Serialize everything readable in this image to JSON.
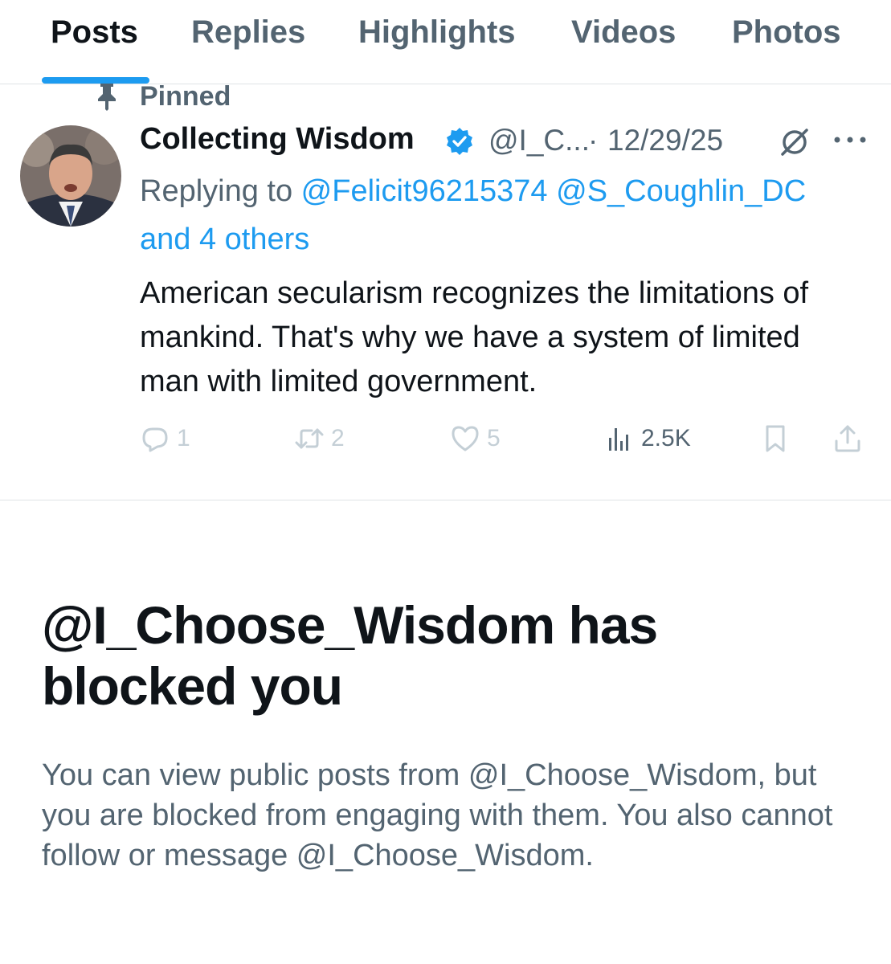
{
  "tabs": [
    {
      "label": "Posts",
      "active": true
    },
    {
      "label": "Replies",
      "active": false
    },
    {
      "label": "Highlights",
      "active": false
    },
    {
      "label": "Videos",
      "active": false
    },
    {
      "label": "Photos",
      "active": false
    }
  ],
  "pinned": {
    "label": "Pinned",
    "icon": "pin-icon"
  },
  "post": {
    "display_name": "Collecting Wisdom",
    "verified": true,
    "handle": "@I_C...",
    "separator": "·",
    "date": "12/29/25",
    "replying_to_prefix": "Replying to ",
    "mention_1": "@Felicit96215374",
    "mention_2": "@S_Coughlin_DC",
    "mention_others": "and 4 others",
    "text": "American secularism recognizes the limitations of mankind. That's why we have a system of limited man with limited government.",
    "replies": "1",
    "reposts": "2",
    "likes": "5",
    "views": "2.5K"
  },
  "blocked": {
    "title": "@I_Choose_Wisdom has blocked you",
    "description": "You can view public posts from @I_Choose_Wisdom, but you are blocked from engaging with them. You also cannot follow or message @I_Choose_Wisdom."
  },
  "colors": {
    "accent": "#1d9bf0",
    "text_primary": "#0f1419",
    "text_secondary": "#536471",
    "disabled_icon": "#c4cfd6"
  }
}
